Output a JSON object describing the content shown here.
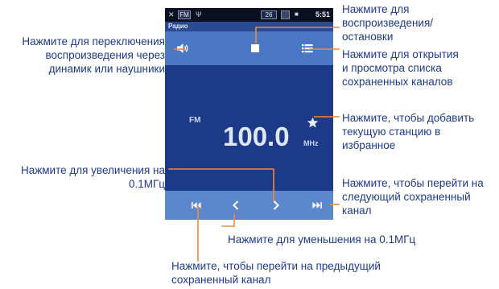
{
  "statusbar": {
    "signal_label": "26",
    "time": "5:51",
    "fm_badge": "FM"
  },
  "app": {
    "title": "Радио"
  },
  "station": {
    "band": "FM",
    "frequency": "100.0",
    "unit": "MHz"
  },
  "icons": {
    "speaker": "speaker-icon",
    "stop": "stop-icon",
    "list": "list-icon",
    "favorite": "star-icon",
    "prev_saved": "skip-back-icon",
    "step_down": "chevron-left-icon",
    "step_up": "chevron-right-icon",
    "next_saved": "skip-forward-icon"
  },
  "annotations": {
    "speaker_toggle": [
      "Нажмите для переключения",
      "воспроизведения через",
      "динамик или наушники"
    ],
    "play_stop": [
      "Нажмите для",
      "воспроизведения/",
      "остановки"
    ],
    "saved_list": [
      "Нажмите для открытия",
      "и просмотра списка",
      "сохраненных каналов"
    ],
    "add_favorite": [
      "Нажмите, чтобы добавить",
      "текущую станцию в",
      "избранное"
    ],
    "step_up": [
      "Нажмите для увеличения на",
      "0.1МГц"
    ],
    "next_saved": [
      "Нажмите, чтобы перейти на",
      "следующий сохраненный",
      "канал"
    ],
    "step_down": [
      "Нажмите для уменьшения на 0.1МГц"
    ],
    "prev_saved": [
      "Нажмите, чтобы перейти на предыдущий",
      "сохраненный канал"
    ]
  },
  "colors": {
    "annotation_text": "#1f3a8c",
    "leader_line": "#f0883a",
    "screen_bg": "#1c3a88",
    "control_bar": "#4b77c4"
  }
}
